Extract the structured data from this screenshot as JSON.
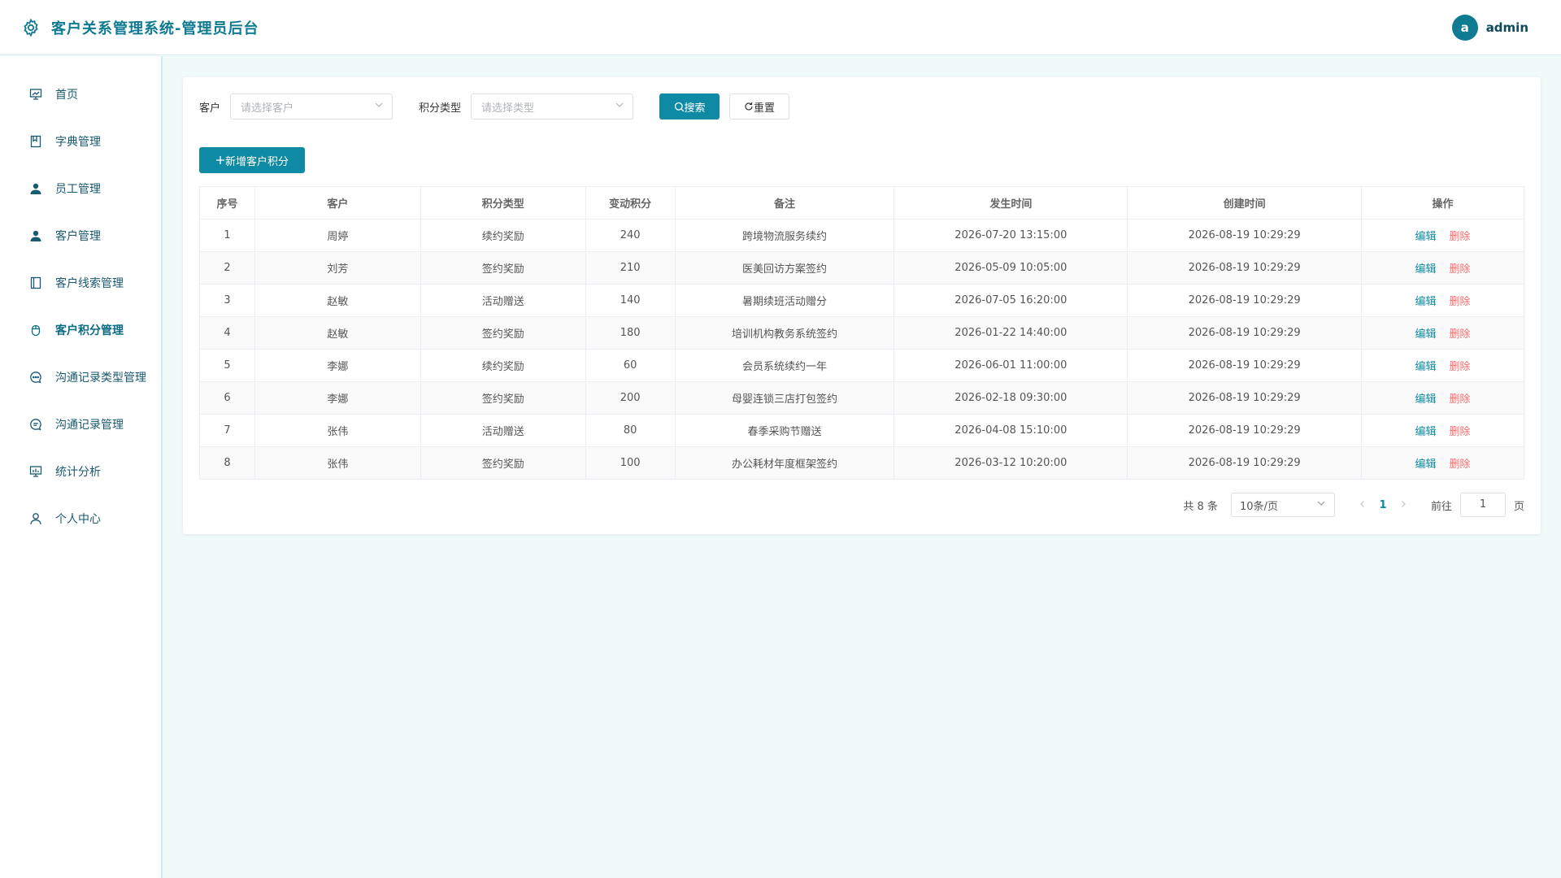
{
  "header": {
    "title": "客户关系管理系统-管理员后台",
    "avatar_letter": "a",
    "username": "admin"
  },
  "sidebar": {
    "items": [
      {
        "label": "首页",
        "icon": "dashboard-icon"
      },
      {
        "label": "字典管理",
        "icon": "book-icon"
      },
      {
        "label": "员工管理",
        "icon": "user-icon"
      },
      {
        "label": "客户管理",
        "icon": "user-icon"
      },
      {
        "label": "客户线索管理",
        "icon": "document-icon"
      },
      {
        "label": "客户积分管理",
        "icon": "mouse-icon"
      },
      {
        "label": "沟通记录类型管理",
        "icon": "chat-dot-icon"
      },
      {
        "label": "沟通记录管理",
        "icon": "chat-line-icon"
      },
      {
        "label": "统计分析",
        "icon": "chart-icon"
      },
      {
        "label": "个人中心",
        "icon": "person-icon"
      }
    ],
    "active_index": 5
  },
  "filters": {
    "customer_label": "客户",
    "customer_placeholder": "请选择客户",
    "type_label": "积分类型",
    "type_placeholder": "请选择类型",
    "search_label": "搜索",
    "reset_label": "重置"
  },
  "add_button_label": "新增客户积分",
  "table": {
    "headers": [
      "序号",
      "客户",
      "积分类型",
      "变动积分",
      "备注",
      "发生时间",
      "创建时间",
      "操作"
    ],
    "edit_label": "编辑",
    "delete_label": "删除",
    "rows": [
      [
        "1",
        "周婷",
        "续约奖励",
        "240",
        "跨境物流服务续约",
        "2026-07-20 13:15:00",
        "2026-08-19 10:29:29"
      ],
      [
        "2",
        "刘芳",
        "签约奖励",
        "210",
        "医美回访方案签约",
        "2026-05-09 10:05:00",
        "2026-08-19 10:29:29"
      ],
      [
        "3",
        "赵敏",
        "活动赠送",
        "140",
        "暑期续班活动赠分",
        "2026-07-05 16:20:00",
        "2026-08-19 10:29:29"
      ],
      [
        "4",
        "赵敏",
        "签约奖励",
        "180",
        "培训机构教务系统签约",
        "2026-01-22 14:40:00",
        "2026-08-19 10:29:29"
      ],
      [
        "5",
        "李娜",
        "续约奖励",
        "60",
        "会员系统续约一年",
        "2026-06-01 11:00:00",
        "2026-08-19 10:29:29"
      ],
      [
        "6",
        "李娜",
        "签约奖励",
        "200",
        "母婴连锁三店打包签约",
        "2026-02-18 09:30:00",
        "2026-08-19 10:29:29"
      ],
      [
        "7",
        "张伟",
        "活动赠送",
        "80",
        "春季采购节赠送",
        "2026-04-08 15:10:00",
        "2026-08-19 10:29:29"
      ],
      [
        "8",
        "张伟",
        "签约奖励",
        "100",
        "办公耗材年度框架签约",
        "2026-03-12 10:20:00",
        "2026-08-19 10:29:29"
      ]
    ]
  },
  "pagination": {
    "total": "共 8 条",
    "page_size": "10条/页",
    "current_page": "1",
    "goto_label": "前往",
    "goto_value": "1",
    "page_suffix": "页"
  }
}
